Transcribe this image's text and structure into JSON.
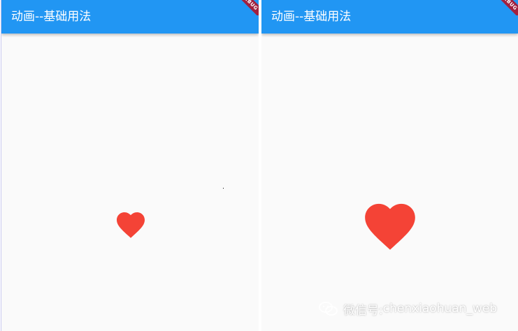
{
  "left_screen": {
    "appbar_title": "动画--基础用法",
    "debug_banner": "DEBUG",
    "heart": {
      "icon": "heart-icon",
      "color": "#f44336",
      "scale": "small"
    }
  },
  "right_screen": {
    "appbar_title": "动画--基础用法",
    "debug_banner": "DEBUG",
    "heart": {
      "icon": "heart-icon",
      "color": "#f44336",
      "scale": "large"
    }
  },
  "watermark": {
    "icon": "wechat-icon",
    "label_prefix": "微信号: ",
    "account": "chenxiaohuan_web"
  },
  "colors": {
    "appbar": "#2196f3",
    "background": "#fafafa",
    "heart": "#f44336",
    "debug_ribbon": "#a0213f"
  }
}
